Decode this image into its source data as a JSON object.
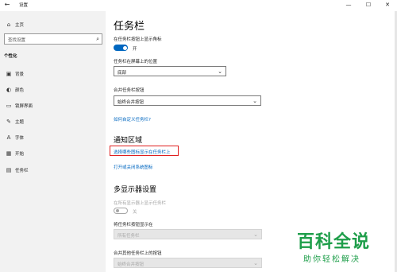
{
  "window": {
    "title": "设置",
    "back_glyph": "←",
    "minimize_glyph": "—",
    "maximize_glyph": "☐",
    "close_glyph": "✕"
  },
  "sidebar": {
    "home_label": "主页",
    "search_placeholder": "查找设置",
    "section_title": "个性化",
    "items": [
      {
        "label": "背景",
        "icon": "image-icon"
      },
      {
        "label": "颜色",
        "icon": "palette-icon"
      },
      {
        "label": "锁屏界面",
        "icon": "lock-screen-icon"
      },
      {
        "label": "主题",
        "icon": "theme-icon"
      },
      {
        "label": "字体",
        "icon": "font-icon"
      },
      {
        "label": "开始",
        "icon": "start-icon"
      },
      {
        "label": "任务栏",
        "icon": "taskbar-icon"
      }
    ]
  },
  "main": {
    "title": "任务栏",
    "badge_label": "在任务栏按钮上显示角标",
    "badge_toggle_state": "开",
    "position_label": "任务栏在屏幕上的位置",
    "position_value": "底部",
    "combine_label": "合并任务栏按钮",
    "combine_value": "始终合并按钮",
    "customize_link": "如何自定义任务栏?",
    "notification_heading": "通知区域",
    "select_icons_link": "选择哪些图标显示在任务栏上",
    "system_icons_link": "打开或关闭系统图标",
    "multi_heading": "多显示器设置",
    "show_all_label": "在所有显示器上显示任务栏",
    "show_all_state": "关",
    "show_buttons_label": "将任务栏按钮显示在",
    "show_buttons_value": "所有任务栏",
    "combine_other_label": "合并其他任务栏上的按钮",
    "combine_other_value": "始终合并按钮"
  },
  "watermark": {
    "main": "百科全说",
    "sub": "助你轻松解决"
  },
  "colors": {
    "accent": "#0067c0",
    "highlight": "#e02020",
    "watermark": "#1e9e4a",
    "sidebar_bg": "#f2f2f2"
  }
}
